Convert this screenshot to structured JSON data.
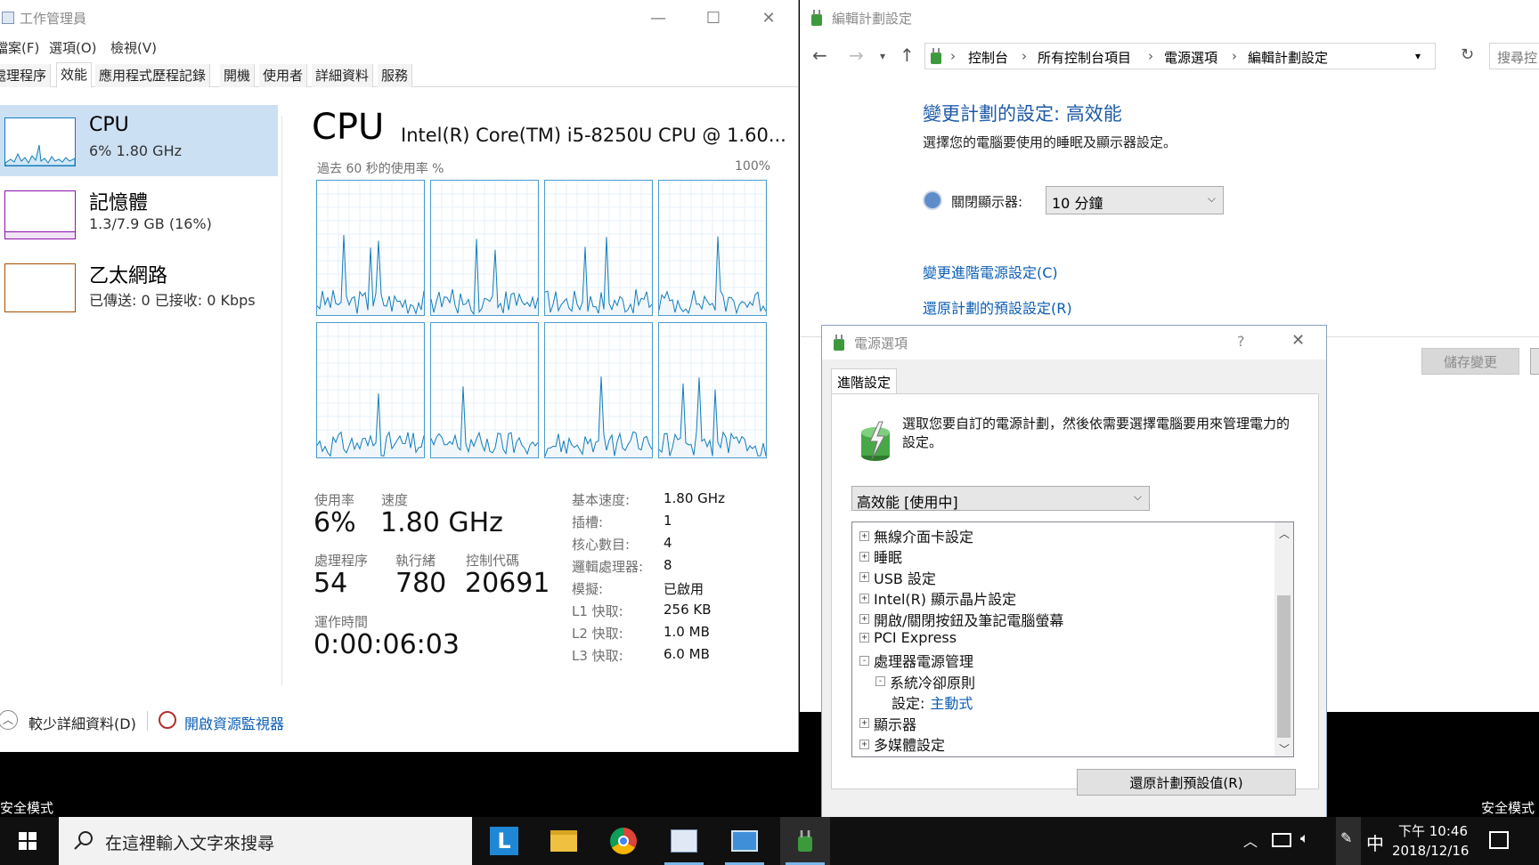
{
  "task_manager": {
    "title": "工作管理員",
    "menu": [
      "檔案(F)",
      "選項(O)",
      "檢視(V)"
    ],
    "tabs": [
      "處理程序",
      "效能",
      "應用程式歷程記錄",
      "開機",
      "使用者",
      "詳細資料",
      "服務"
    ],
    "active_tab": "效能",
    "sidebar": [
      {
        "name": "CPU",
        "detail": "6% 1.80 GHz",
        "color": "#117dbb"
      },
      {
        "name": "記憶體",
        "detail": "1.3/7.9 GB (16%)",
        "color": "#8b12ae"
      },
      {
        "name": "乙太網路",
        "detail": "已傳送: 0 已接收: 0 Kbps",
        "color": "#a74f01"
      }
    ],
    "cpu": {
      "heading": "CPU",
      "model": "Intel(R) Core(TM) i5-8250U CPU @ 1.60...",
      "graph_label": "過去 60 秒的使用率 %",
      "graph_max": "100%",
      "logical_graph_count": 8,
      "stats": {
        "util_label": "使用率",
        "util_value": "6%",
        "speed_label": "速度",
        "speed_value": "1.80 GHz",
        "proc_label": "處理程序",
        "proc_value": "54",
        "threads_label": "執行緒",
        "threads_value": "780",
        "handles_label": "控制代碼",
        "handles_value": "20691",
        "uptime_label": "運作時間",
        "uptime_value": "0:00:06:03"
      },
      "details": [
        {
          "label": "基本速度:",
          "value": "1.80 GHz"
        },
        {
          "label": "插槽:",
          "value": "1"
        },
        {
          "label": "核心數目:",
          "value": "4"
        },
        {
          "label": "邏輯處理器:",
          "value": "8"
        },
        {
          "label": "模擬:",
          "value": "已啟用"
        },
        {
          "label": "L1 快取:",
          "value": "256 KB"
        },
        {
          "label": "L2 快取:",
          "value": "1.0 MB"
        },
        {
          "label": "L3 快取:",
          "value": "6.0 MB"
        }
      ]
    },
    "footer": {
      "fewer_details": "較少詳細資料(D)",
      "resource_monitor": "開啟資源監視器"
    }
  },
  "edit_plan": {
    "title": "編輯計劃設定",
    "breadcrumb": [
      "控制台",
      "所有控制台項目",
      "電源選項",
      "編輯計劃設定"
    ],
    "search_placeholder": "搜尋控",
    "heading": "變更計劃的設定: 高效能",
    "description": "選擇您的電腦要使用的睡眠及顯示器設定。",
    "display_off_label": "關閉顯示器:",
    "display_off_value": "10 分鐘",
    "link_advanced": "變更進階電源設定(C)",
    "link_restore": "還原計劃的預設設定(R)",
    "save_button": "儲存變更"
  },
  "power_options": {
    "title": "電源選項",
    "help": "?",
    "tab": "進階設定",
    "description": "選取您要自訂的電源計劃，然後依需要選擇電腦要用來管理電力的設定。",
    "plan": "高效能 [使用中]",
    "tree": [
      {
        "text": "無線介面卡設定",
        "level": 0,
        "state": "+"
      },
      {
        "text": "睡眠",
        "level": 0,
        "state": "+"
      },
      {
        "text": "USB 設定",
        "level": 0,
        "state": "+"
      },
      {
        "text": "Intel(R) 顯示晶片設定",
        "level": 0,
        "state": "+"
      },
      {
        "text": "開啟/關閉按鈕及筆記電腦螢幕",
        "level": 0,
        "state": "+"
      },
      {
        "text": "PCI Express",
        "level": 0,
        "state": "+"
      },
      {
        "text": "處理器電源管理",
        "level": 0,
        "state": "-"
      },
      {
        "text": "系統冷卻原則",
        "level": 1,
        "state": "-"
      },
      {
        "text": "設定:",
        "level": 2,
        "state": "",
        "value": "主動式"
      },
      {
        "text": "顯示器",
        "level": 0,
        "state": "+"
      },
      {
        "text": "多媒體設定",
        "level": 0,
        "state": "+"
      }
    ],
    "restore_button": "還原計劃預設值(R)"
  },
  "desktop": {
    "safe_mode": "安全模式"
  },
  "taskbar": {
    "search_placeholder": "在這裡輸入文字來搜尋",
    "ime": "中",
    "time": "下午 10:46",
    "date": "2018/12/16"
  }
}
